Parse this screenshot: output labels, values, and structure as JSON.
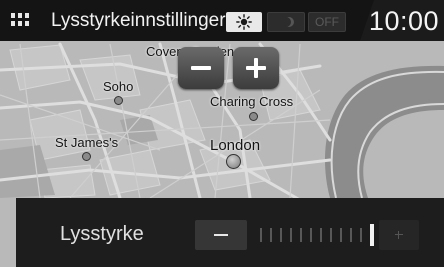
{
  "header": {
    "title": "Lysstyrkeinnstillinger",
    "menu_icon": "grid-menu-icon",
    "modes": {
      "day_icon": "sun-icon",
      "night_icon": "moon-icon",
      "off_label": "OFF",
      "selected": "day"
    },
    "clock": "10:00"
  },
  "map": {
    "places": {
      "covent_garden": "Covent Garden",
      "soho": "Soho",
      "charing_cross": "Charing Cross",
      "st_james": "St James's",
      "london": "London"
    },
    "zoom_out_icon": "minus-icon",
    "zoom_in_icon": "plus-icon"
  },
  "brightness": {
    "label": "Lysstyrke",
    "decrease_icon": "minus-icon",
    "increase_icon": "plus-icon",
    "level": 12,
    "max": 12
  },
  "colors": {
    "header_bg": "#141414",
    "panel_bg": "#1d1d1d",
    "map_bg": "#bcbcbc",
    "water": "#8c8c8c"
  }
}
